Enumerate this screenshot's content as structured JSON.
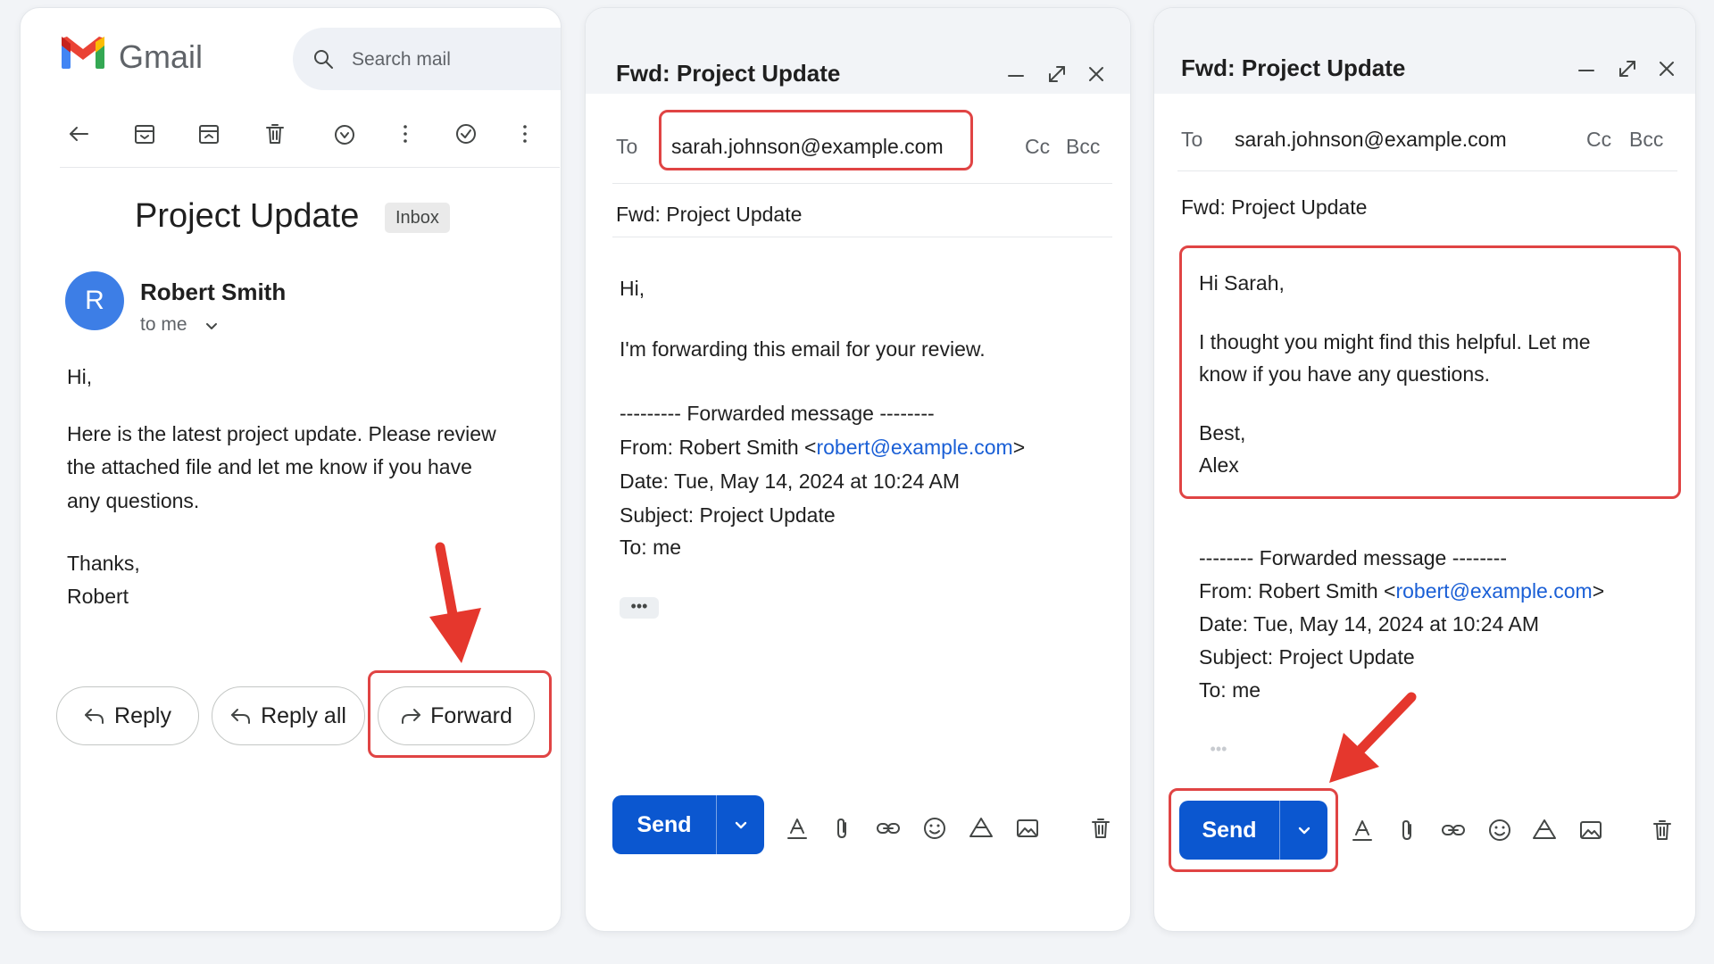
{
  "colors": {
    "accent": "#0b57d0",
    "highlight": "#e04444",
    "link": "#1a5fd6",
    "avatar": "#3d7ee6"
  },
  "panel1": {
    "app_name": "Gmail",
    "search_placeholder": "Search mail",
    "toolbar_icons": [
      "back-arrow-icon",
      "archive-icon",
      "move-to-icon",
      "delete-icon",
      "snooze-icon",
      "more-vert-icon",
      "add-task-icon",
      "more-vert-icon"
    ],
    "subject": "Project Update",
    "label_badge": "Inbox",
    "avatar_letter": "R",
    "sender_name": "Robert Smith",
    "recipient_line": "to me",
    "body": {
      "greeting": "Hi,",
      "paragraph_lines": [
        "Here is the latest project update. Please review",
        "the attached file and let me know if you have",
        "any questions."
      ],
      "signoff": "Thanks,",
      "signature": "Robert"
    },
    "actions": {
      "reply": "Reply",
      "reply_all": "Reply all",
      "forward": "Forward"
    }
  },
  "panel2": {
    "title": "Fwd: Project Update",
    "to_label": "To",
    "to_value": "sarah.johnson@example.com",
    "cc": "Cc",
    "bcc": "Bcc",
    "subject": "Fwd: Project Update",
    "body": {
      "greeting": "Hi,",
      "message": "I'm forwarding this email for your review.",
      "fwd_header": "--------- Forwarded message --------",
      "from_prefix": "From: Robert Smith <",
      "from_email": "robert@example.com",
      "from_suffix": ">",
      "date": "Date: Tue, May 14, 2024 at 10:24 AM",
      "subject_line": "Subject: Project Update",
      "to_line": "To: me"
    },
    "ellipsis": "•••",
    "send": "Send"
  },
  "panel3": {
    "title": "Fwd: Project Update",
    "to_label": "To",
    "to_value": "sarah.johnson@example.com",
    "cc": "Cc",
    "bcc": "Bcc",
    "subject": "Fwd: Project Update",
    "body": {
      "greeting": "Hi Sarah,",
      "message_lines": [
        "I thought you might find this helpful. Let me",
        "know if you have any questions."
      ],
      "signoff": "Best,",
      "signature": "Alex",
      "fwd_header": "-------- Forwarded message --------",
      "from_prefix": "From: Robert Smith <",
      "from_email": "robert@example.com",
      "from_suffix": ">",
      "date": "Date: Tue, May 14, 2024 at 10:24 AM",
      "subject_line": "Subject: Project Update",
      "to_line": "To: me"
    },
    "ellipsis": "•••",
    "send": "Send"
  }
}
